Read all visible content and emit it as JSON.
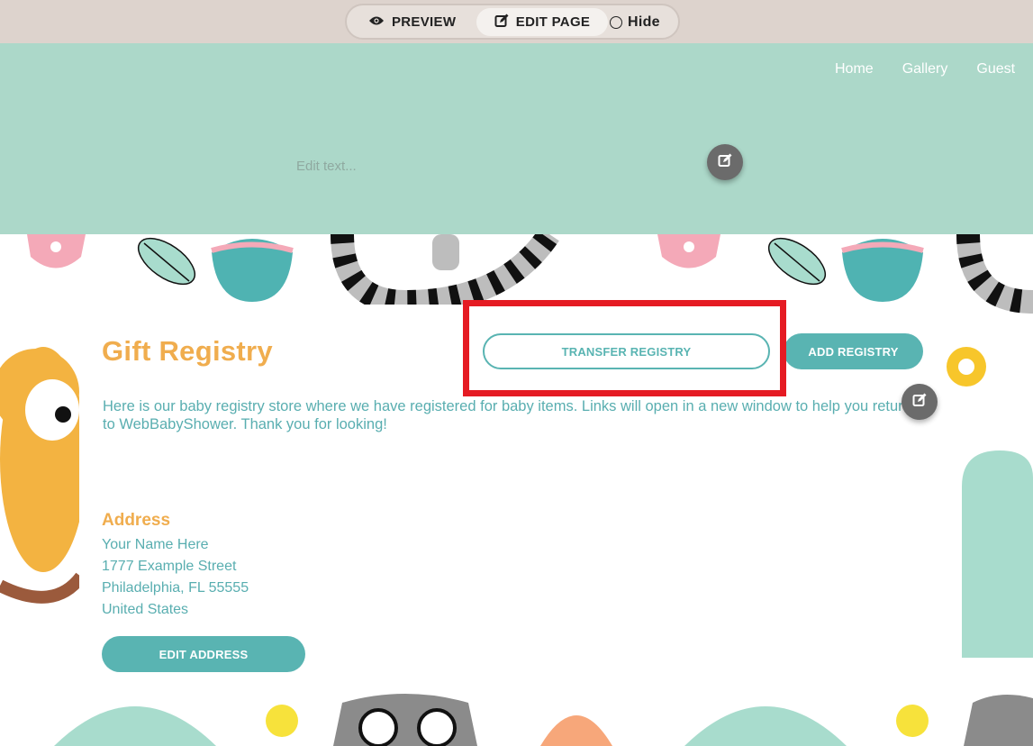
{
  "toolbar": {
    "preview_label": "PREVIEW",
    "edit_page_label": "EDIT PAGE",
    "hide_label": "Hide"
  },
  "header": {
    "nav": [
      "Home",
      "Gallery",
      "Guest"
    ],
    "placeholder": "Edit text..."
  },
  "registry": {
    "title": "Gift Registry",
    "transfer_label": "TRANSFER REGISTRY",
    "add_label": "ADD REGISTRY",
    "description": "Here is our baby registry store where we have registered for baby items. Links will open in a new window to help you return to WebBabyShower. Thank you for looking!"
  },
  "address": {
    "heading": "Address",
    "lines": [
      "Your Name Here",
      "1777 Example Street",
      "Philadelphia, FL 55555",
      "United States"
    ],
    "edit_label": "EDIT ADDRESS"
  },
  "colors": {
    "accent_teal": "#59b4b2",
    "accent_orange": "#f0ad4e",
    "header_bg": "#acd8c9",
    "highlight_red": "#e51b23"
  }
}
